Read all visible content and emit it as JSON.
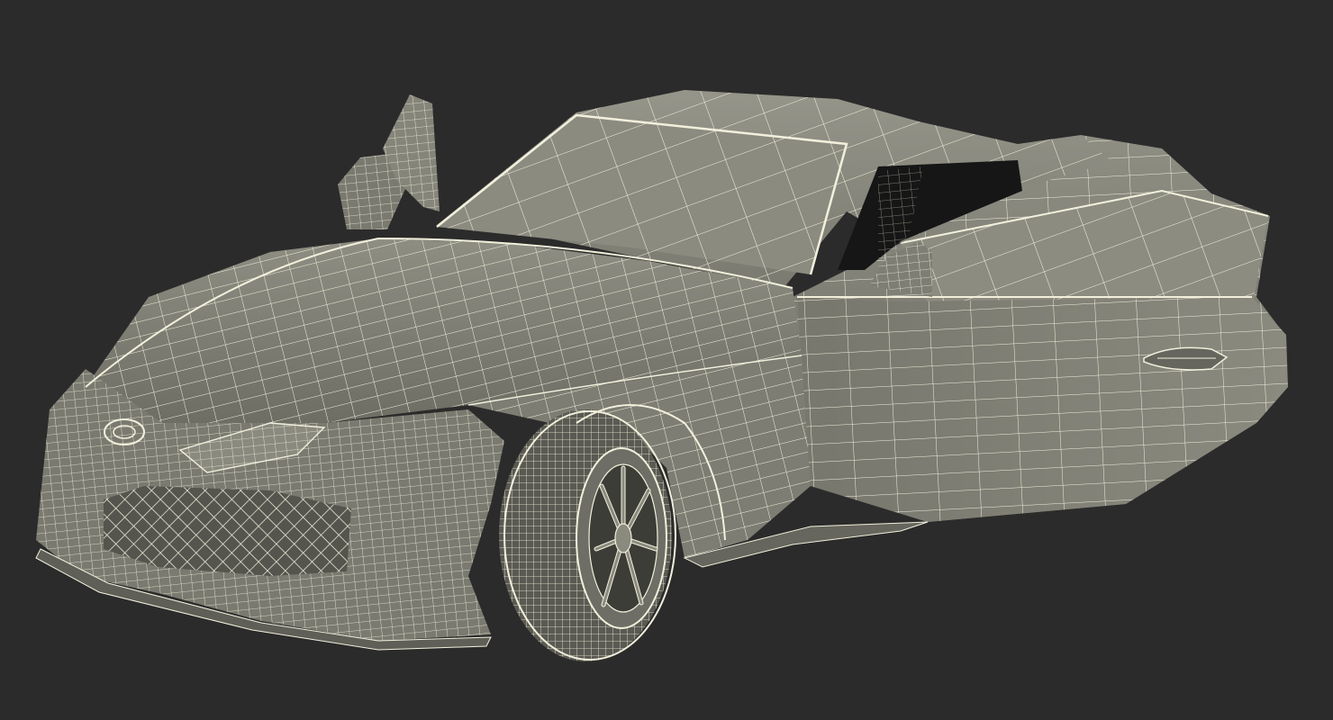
{
  "scene": {
    "subject": "sports-car-wireframe-render",
    "colors": {
      "background": "#2b2b2b",
      "surface_light": "#8a8a7e",
      "surface_mid": "#75756b",
      "surface_dark": "#5d5d55",
      "wire": "#f2f0dc",
      "cabin": "#1a1a1a",
      "tire": "#6e6e66"
    }
  }
}
